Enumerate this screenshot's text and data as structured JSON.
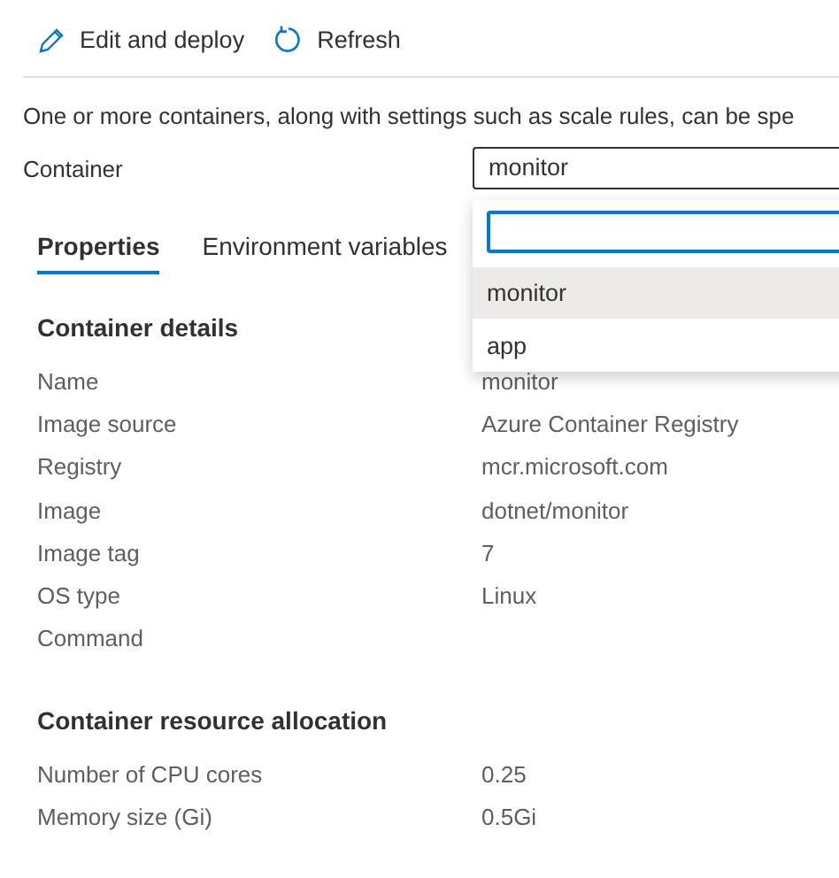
{
  "toolbar": [
    {
      "kind": "edit",
      "label": "Edit and deploy"
    },
    {
      "kind": "refresh",
      "label": "Refresh"
    }
  ],
  "description": "One or more containers, along with settings such as scale rules, can be spe",
  "container_select": {
    "label": "Container",
    "value": "monitor",
    "expanded": true,
    "options": [
      {
        "label": "monitor",
        "selected": true
      },
      {
        "label": "app",
        "selected": false
      }
    ]
  },
  "tabs": [
    {
      "label": "Properties",
      "selected": true
    },
    {
      "label": "Environment variables",
      "selected": false
    }
  ],
  "sections": [
    {
      "title": "Container details",
      "rows": [
        {
          "label": "Name",
          "value": "monitor"
        },
        {
          "label": "Image source",
          "value": "Azure Container Registry"
        },
        {
          "label": "Registry",
          "value": "mcr.microsoft.com"
        },
        {
          "label": "Image",
          "value": "dotnet/monitor"
        },
        {
          "label": "Image tag",
          "value": "7"
        },
        {
          "label": "OS type",
          "value": "Linux"
        },
        {
          "label": "Command",
          "value": ""
        }
      ]
    },
    {
      "title": "Container resource allocation",
      "rows": [
        {
          "label": "Number of CPU cores",
          "value": "0.25"
        },
        {
          "label": "Memory size (Gi)",
          "value": "0.5Gi"
        }
      ]
    }
  ]
}
